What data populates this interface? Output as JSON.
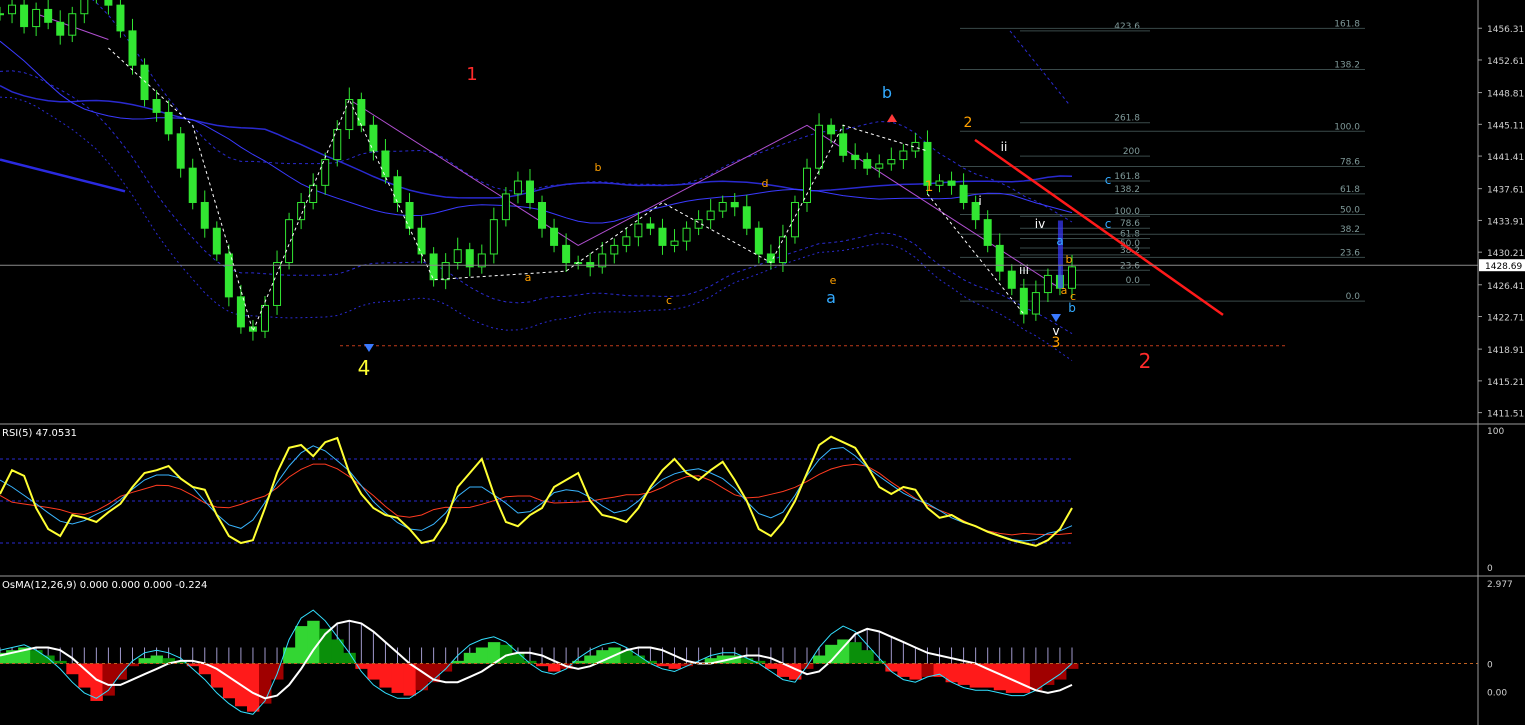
{
  "colors": {
    "background": "#000000",
    "grid_sep": "#9a9a9a",
    "price_candle": "#32e632",
    "zigzag": "#ffffff",
    "ma_blue": "#2a2ad0",
    "envelope": "#2a2ad0",
    "channel_violet": "#b04fd0",
    "fib": "#3a4a4a",
    "fib_text": "#7f9999",
    "trend_red": "#ff1a1a",
    "rsi_main": "#ffff33",
    "rsi_fast": "#39b5ff",
    "rsi_slow": "#ff3b20",
    "osma_pos_light": "#33d633",
    "osma_pos_dark": "#0a8f0a",
    "osma_neg_light": "#ff1a1a",
    "osma_neg_dark": "#a00000",
    "osma_white": "#ffffff",
    "osma_cyan": "#33e0ff",
    "osma_bars": "#c8c0ff",
    "axis_text": "#d0d0d0"
  },
  "chart_data": [
    {
      "type": "line",
      "panel": "price",
      "y_ticks": [
        "1456.31",
        "1452.61",
        "1448.81",
        "1445.11",
        "1441.41",
        "1437.61",
        "1433.91",
        "1430.21",
        "1426.41",
        "1422.71",
        "1418.91",
        "1415.21",
        "1411.51"
      ],
      "ylim": [
        1410.3,
        1459.6
      ],
      "current_price": "1428.69",
      "close": [
        1458.0,
        1459.0,
        1456.5,
        1458.5,
        1457.0,
        1455.5,
        1458.0,
        1460.0,
        1462.0,
        1459.0,
        1456.0,
        1452.0,
        1448.0,
        1446.5,
        1444.0,
        1440.0,
        1436.0,
        1433.0,
        1430.0,
        1425.0,
        1421.5,
        1421.0,
        1424.0,
        1429.0,
        1434.0,
        1436.0,
        1438.0,
        1441.0,
        1444.5,
        1448.0,
        1445.0,
        1442.0,
        1439.0,
        1436.0,
        1433.0,
        1430.0,
        1427.0,
        1429.0,
        1430.5,
        1428.5,
        1430.0,
        1434.0,
        1437.0,
        1438.5,
        1436.0,
        1433.0,
        1431.0,
        1429.0,
        1429.0,
        1428.5,
        1430.0,
        1431.0,
        1432.0,
        1433.5,
        1433.0,
        1431.0,
        1431.5,
        1433.0,
        1434.0,
        1435.0,
        1436.0,
        1435.5,
        1433.0,
        1430.0,
        1429.0,
        1432.0,
        1436.0,
        1440.0,
        1445.0,
        1444.0,
        1441.5,
        1441.0,
        1440.0,
        1440.5,
        1441.0,
        1442.0,
        1443.0,
        1438.0,
        1438.5,
        1438.0,
        1436.0,
        1434.0,
        1431.0,
        1428.0,
        1426.0,
        1423.0,
        1425.5,
        1427.5,
        1426.0,
        1428.5
      ],
      "price_labels": [
        {
          "t": "1",
          "c": "#ff2a2a",
          "s": 18
        },
        {
          "t": "4",
          "c": "#ffff33",
          "s": 20
        },
        {
          "t": "a",
          "c": "#ffa000",
          "s": 11
        },
        {
          "t": "b",
          "c": "#ffa000",
          "s": 11
        },
        {
          "t": "c",
          "c": "#ffa000",
          "s": 11
        },
        {
          "t": "d",
          "c": "#ffa000",
          "s": 11
        },
        {
          "t": "e",
          "c": "#ffa000",
          "s": 11
        },
        {
          "t": "a",
          "c": "#33aaff",
          "s": 16
        },
        {
          "t": "b",
          "c": "#33aaff",
          "s": 16
        },
        {
          "t": "2",
          "c": "#ffa000",
          "s": 14
        },
        {
          "t": "1",
          "c": "#ffa000",
          "s": 14
        },
        {
          "t": "ii",
          "c": "#ffffff",
          "s": 12
        },
        {
          "t": "i",
          "c": "#ffffff",
          "s": 12
        },
        {
          "t": "iv",
          "c": "#ffffff",
          "s": 12
        },
        {
          "t": "iii",
          "c": "#ffffff",
          "s": 12
        },
        {
          "t": "v",
          "c": "#ffffff",
          "s": 12
        },
        {
          "t": "3",
          "c": "#ffa000",
          "s": 14
        },
        {
          "t": "a",
          "c": "#33aaff",
          "s": 12
        },
        {
          "t": "b",
          "c": "#ffa000",
          "s": 11
        },
        {
          "t": "a",
          "c": "#ffa000",
          "s": 11
        },
        {
          "t": "c",
          "c": "#ffa000",
          "s": 11
        },
        {
          "t": "b",
          "c": "#33aaff",
          "s": 12
        },
        {
          "t": "c",
          "c": "#33aaff",
          "s": 12
        },
        {
          "t": "c",
          "c": "#33aaff",
          "s": 12
        },
        {
          "t": "2",
          "c": "#ff2a2a",
          "s": 20
        }
      ],
      "fib_left": [
        {
          "label": "423.6",
          "v": 1456.0
        },
        {
          "label": "261.8",
          "v": 1445.3
        },
        {
          "label": "200",
          "v": 1441.4
        },
        {
          "label": "161.8",
          "v": 1438.5
        },
        {
          "label": "138.2",
          "v": 1437.0
        },
        {
          "label": "100.0",
          "v": 1434.4
        },
        {
          "label": "78.6",
          "v": 1433.0
        },
        {
          "label": "61.8",
          "v": 1431.8
        },
        {
          "label": "50.0",
          "v": 1430.7
        },
        {
          "label": "38.2",
          "v": 1429.9
        },
        {
          "label": "23.6",
          "v": 1428.1
        },
        {
          "label": "0.0",
          "v": 1426.4
        }
      ],
      "fib_right": [
        {
          "label": "161.8",
          "v": 1456.3
        },
        {
          "label": "138.2",
          "v": 1451.5
        },
        {
          "label": "100.0",
          "v": 1444.3
        },
        {
          "label": "78.6",
          "v": 1440.2
        },
        {
          "label": "61.8",
          "v": 1437.0
        },
        {
          "label": "50.0",
          "v": 1434.6
        },
        {
          "label": "38.2",
          "v": 1432.3
        },
        {
          "label": "23.6",
          "v": 1429.6
        },
        {
          "label": "0.0",
          "v": 1424.5
        }
      ]
    },
    {
      "type": "line",
      "panel": "rsi",
      "title": "RSI(5) 47.0531",
      "y_ticks": [
        "100",
        "0"
      ],
      "ylim": [
        0,
        100
      ],
      "levels": [
        80,
        20,
        50
      ],
      "values": [
        55,
        72,
        68,
        45,
        30,
        25,
        40,
        38,
        35,
        42,
        48,
        60,
        70,
        72,
        75,
        66,
        60,
        58,
        40,
        25,
        20,
        22,
        45,
        70,
        88,
        90,
        82,
        92,
        95,
        70,
        55,
        45,
        40,
        38,
        30,
        20,
        22,
        35,
        60,
        70,
        80,
        55,
        35,
        32,
        40,
        45,
        60,
        65,
        70,
        50,
        40,
        38,
        35,
        45,
        60,
        72,
        80,
        70,
        65,
        72,
        78,
        65,
        50,
        30,
        25,
        35,
        50,
        70,
        90,
        96,
        92,
        88,
        75,
        60,
        55,
        60,
        58,
        45,
        38,
        40,
        35,
        32,
        28,
        25,
        22,
        20,
        18,
        22,
        30,
        45
      ]
    },
    {
      "type": "bar",
      "panel": "osma",
      "title": "OsMA(12,26,9) 0.000 0.000 0.000 -0.224",
      "y_ticks": [
        "2.977",
        "0",
        "0.00"
      ],
      "ylim": [
        -2.3,
        3.2
      ],
      "values": [
        0.4,
        0.5,
        0.6,
        0.5,
        0.3,
        0.1,
        -0.4,
        -0.9,
        -1.4,
        -1.2,
        -0.6,
        -0.1,
        0.2,
        0.3,
        0.2,
        0.1,
        -0.1,
        -0.4,
        -0.9,
        -1.3,
        -1.6,
        -1.8,
        -1.5,
        -0.6,
        0.6,
        1.4,
        1.6,
        1.3,
        0.9,
        0.4,
        -0.2,
        -0.6,
        -0.9,
        -1.1,
        -1.2,
        -1.0,
        -0.7,
        -0.3,
        0.1,
        0.4,
        0.6,
        0.8,
        0.7,
        0.4,
        0.1,
        -0.1,
        -0.3,
        -0.2,
        0.1,
        0.3,
        0.5,
        0.6,
        0.5,
        0.3,
        0.1,
        -0.1,
        -0.2,
        -0.1,
        0.0,
        0.2,
        0.3,
        0.3,
        0.2,
        0.1,
        -0.2,
        -0.5,
        -0.6,
        -0.2,
        0.3,
        0.7,
        0.9,
        0.8,
        0.5,
        0.1,
        -0.3,
        -0.5,
        -0.6,
        -0.5,
        -0.5,
        -0.7,
        -0.8,
        -0.9,
        -0.9,
        -1.0,
        -1.1,
        -1.1,
        -1.0,
        -0.8,
        -0.6,
        -0.2
      ],
      "signal_white": [
        0.3,
        0.4,
        0.5,
        0.6,
        0.6,
        0.5,
        0.2,
        -0.2,
        -0.6,
        -0.8,
        -0.8,
        -0.6,
        -0.4,
        -0.2,
        0.0,
        0.1,
        0.1,
        0.0,
        -0.2,
        -0.5,
        -0.8,
        -1.1,
        -1.3,
        -1.2,
        -0.8,
        -0.2,
        0.5,
        1.1,
        1.5,
        1.6,
        1.5,
        1.2,
        0.8,
        0.4,
        0.0,
        -0.3,
        -0.6,
        -0.7,
        -0.7,
        -0.5,
        -0.3,
        0.0,
        0.3,
        0.4,
        0.4,
        0.3,
        0.1,
        -0.1,
        -0.2,
        -0.1,
        0.1,
        0.3,
        0.5,
        0.6,
        0.6,
        0.5,
        0.3,
        0.1,
        0.0,
        0.0,
        0.1,
        0.2,
        0.3,
        0.3,
        0.2,
        0.0,
        -0.2,
        -0.4,
        -0.3,
        0.1,
        0.6,
        1.1,
        1.3,
        1.2,
        1.0,
        0.8,
        0.6,
        0.4,
        0.3,
        0.2,
        0.1,
        0.0,
        -0.2,
        -0.4,
        -0.6,
        -0.8,
        -1.0,
        -1.1,
        -1.0,
        -0.8
      ],
      "signal_cyan": [
        0.5,
        0.6,
        0.7,
        0.5,
        0.2,
        -0.2,
        -0.7,
        -1.1,
        -1.3,
        -1.0,
        -0.4,
        0.1,
        0.4,
        0.5,
        0.4,
        0.2,
        -0.2,
        -0.6,
        -1.1,
        -1.5,
        -1.8,
        -1.9,
        -1.4,
        -0.4,
        0.9,
        1.7,
        2.0,
        1.6,
        1.0,
        0.4,
        -0.3,
        -0.8,
        -1.1,
        -1.3,
        -1.3,
        -1.0,
        -0.6,
        -0.2,
        0.3,
        0.7,
        0.9,
        1.0,
        0.8,
        0.4,
        0.0,
        -0.3,
        -0.4,
        -0.2,
        0.2,
        0.5,
        0.7,
        0.8,
        0.6,
        0.3,
        0.0,
        -0.2,
        -0.3,
        -0.1,
        0.1,
        0.3,
        0.4,
        0.4,
        0.2,
        0.0,
        -0.3,
        -0.6,
        -0.7,
        -0.1,
        0.6,
        1.1,
        1.4,
        1.2,
        0.7,
        0.2,
        -0.3,
        -0.6,
        -0.7,
        -0.5,
        -0.4,
        -0.7,
        -0.9,
        -1.0,
        -1.0,
        -1.1,
        -1.2,
        -1.2,
        -1.0,
        -0.7,
        -0.4,
        0.0
      ]
    }
  ]
}
